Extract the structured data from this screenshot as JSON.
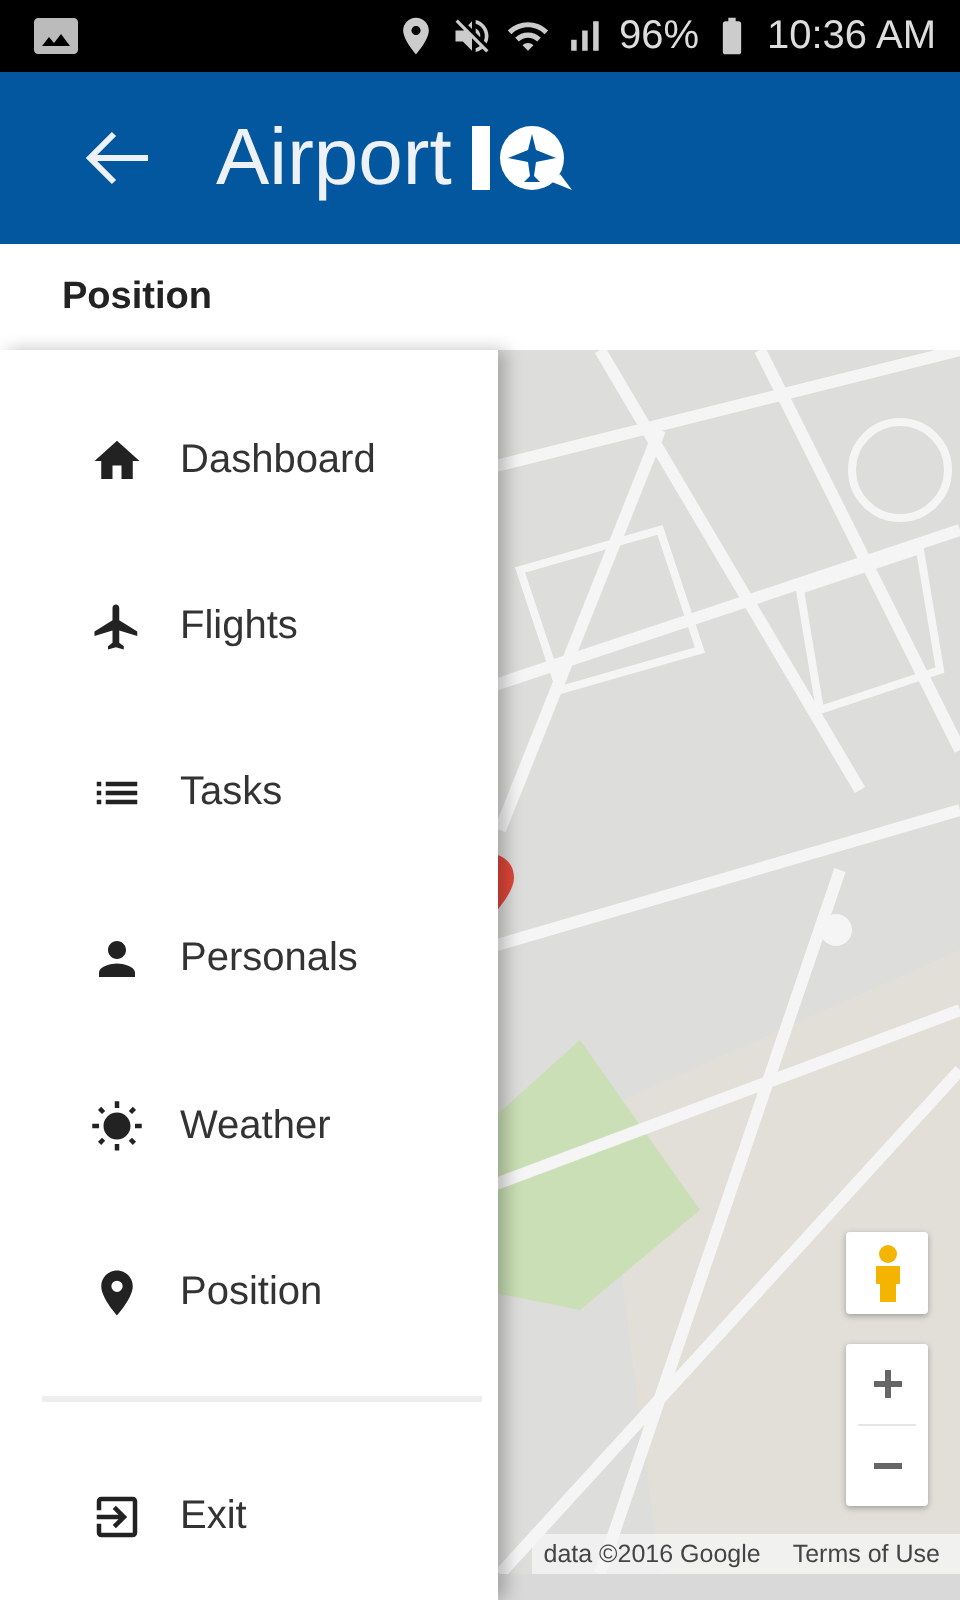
{
  "status_bar": {
    "battery": "96%",
    "time": "10:36 AM"
  },
  "app_bar": {
    "title": "Airport"
  },
  "section": {
    "title": "Position"
  },
  "drawer": {
    "items": [
      {
        "label": "Dashboard",
        "kind": "home"
      },
      {
        "label": "Flights",
        "kind": "plane"
      },
      {
        "label": "Tasks",
        "kind": "list"
      },
      {
        "label": "Personals",
        "kind": "person"
      },
      {
        "label": "Weather",
        "kind": "sun"
      },
      {
        "label": "Position",
        "kind": "pin"
      }
    ],
    "footer_items": [
      {
        "label": "Exit",
        "kind": "exit"
      }
    ]
  },
  "map": {
    "attribution": "data ©2016 Google",
    "terms": "Terms of Use"
  }
}
